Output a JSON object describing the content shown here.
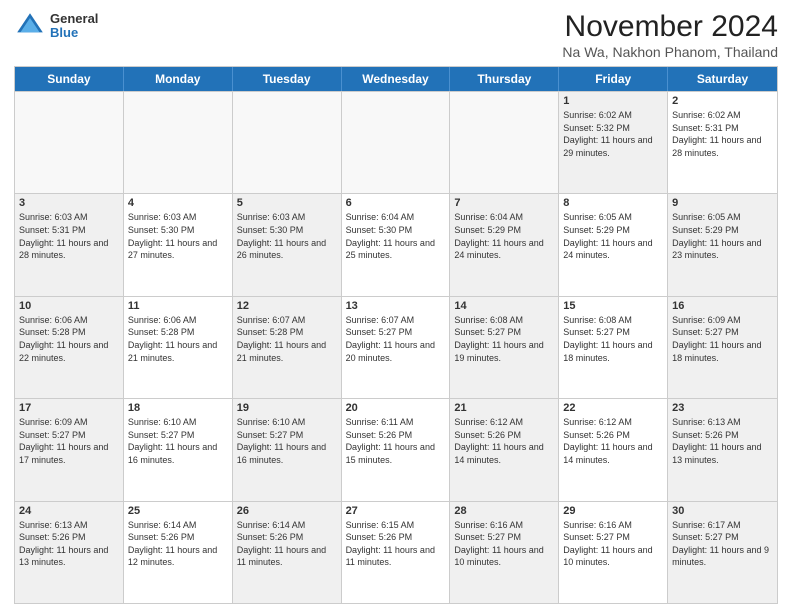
{
  "logo": {
    "general": "General",
    "blue": "Blue"
  },
  "header": {
    "month": "November 2024",
    "location": "Na Wa, Nakhon Phanom, Thailand"
  },
  "weekdays": [
    "Sunday",
    "Monday",
    "Tuesday",
    "Wednesday",
    "Thursday",
    "Friday",
    "Saturday"
  ],
  "rows": [
    [
      {
        "day": "",
        "text": "",
        "empty": true
      },
      {
        "day": "",
        "text": "",
        "empty": true
      },
      {
        "day": "",
        "text": "",
        "empty": true
      },
      {
        "day": "",
        "text": "",
        "empty": true
      },
      {
        "day": "",
        "text": "",
        "empty": true
      },
      {
        "day": "1",
        "text": "Sunrise: 6:02 AM\nSunset: 5:32 PM\nDaylight: 11 hours and 29 minutes.",
        "shaded": true
      },
      {
        "day": "2",
        "text": "Sunrise: 6:02 AM\nSunset: 5:31 PM\nDaylight: 11 hours and 28 minutes.",
        "shaded": false
      }
    ],
    [
      {
        "day": "3",
        "text": "Sunrise: 6:03 AM\nSunset: 5:31 PM\nDaylight: 11 hours and 28 minutes.",
        "shaded": true
      },
      {
        "day": "4",
        "text": "Sunrise: 6:03 AM\nSunset: 5:30 PM\nDaylight: 11 hours and 27 minutes.",
        "shaded": false
      },
      {
        "day": "5",
        "text": "Sunrise: 6:03 AM\nSunset: 5:30 PM\nDaylight: 11 hours and 26 minutes.",
        "shaded": true
      },
      {
        "day": "6",
        "text": "Sunrise: 6:04 AM\nSunset: 5:30 PM\nDaylight: 11 hours and 25 minutes.",
        "shaded": false
      },
      {
        "day": "7",
        "text": "Sunrise: 6:04 AM\nSunset: 5:29 PM\nDaylight: 11 hours and 24 minutes.",
        "shaded": true
      },
      {
        "day": "8",
        "text": "Sunrise: 6:05 AM\nSunset: 5:29 PM\nDaylight: 11 hours and 24 minutes.",
        "shaded": false
      },
      {
        "day": "9",
        "text": "Sunrise: 6:05 AM\nSunset: 5:29 PM\nDaylight: 11 hours and 23 minutes.",
        "shaded": true
      }
    ],
    [
      {
        "day": "10",
        "text": "Sunrise: 6:06 AM\nSunset: 5:28 PM\nDaylight: 11 hours and 22 minutes.",
        "shaded": true
      },
      {
        "day": "11",
        "text": "Sunrise: 6:06 AM\nSunset: 5:28 PM\nDaylight: 11 hours and 21 minutes.",
        "shaded": false
      },
      {
        "day": "12",
        "text": "Sunrise: 6:07 AM\nSunset: 5:28 PM\nDaylight: 11 hours and 21 minutes.",
        "shaded": true
      },
      {
        "day": "13",
        "text": "Sunrise: 6:07 AM\nSunset: 5:27 PM\nDaylight: 11 hours and 20 minutes.",
        "shaded": false
      },
      {
        "day": "14",
        "text": "Sunrise: 6:08 AM\nSunset: 5:27 PM\nDaylight: 11 hours and 19 minutes.",
        "shaded": true
      },
      {
        "day": "15",
        "text": "Sunrise: 6:08 AM\nSunset: 5:27 PM\nDaylight: 11 hours and 18 minutes.",
        "shaded": false
      },
      {
        "day": "16",
        "text": "Sunrise: 6:09 AM\nSunset: 5:27 PM\nDaylight: 11 hours and 18 minutes.",
        "shaded": true
      }
    ],
    [
      {
        "day": "17",
        "text": "Sunrise: 6:09 AM\nSunset: 5:27 PM\nDaylight: 11 hours and 17 minutes.",
        "shaded": true
      },
      {
        "day": "18",
        "text": "Sunrise: 6:10 AM\nSunset: 5:27 PM\nDaylight: 11 hours and 16 minutes.",
        "shaded": false
      },
      {
        "day": "19",
        "text": "Sunrise: 6:10 AM\nSunset: 5:27 PM\nDaylight: 11 hours and 16 minutes.",
        "shaded": true
      },
      {
        "day": "20",
        "text": "Sunrise: 6:11 AM\nSunset: 5:26 PM\nDaylight: 11 hours and 15 minutes.",
        "shaded": false
      },
      {
        "day": "21",
        "text": "Sunrise: 6:12 AM\nSunset: 5:26 PM\nDaylight: 11 hours and 14 minutes.",
        "shaded": true
      },
      {
        "day": "22",
        "text": "Sunrise: 6:12 AM\nSunset: 5:26 PM\nDaylight: 11 hours and 14 minutes.",
        "shaded": false
      },
      {
        "day": "23",
        "text": "Sunrise: 6:13 AM\nSunset: 5:26 PM\nDaylight: 11 hours and 13 minutes.",
        "shaded": true
      }
    ],
    [
      {
        "day": "24",
        "text": "Sunrise: 6:13 AM\nSunset: 5:26 PM\nDaylight: 11 hours and 13 minutes.",
        "shaded": true
      },
      {
        "day": "25",
        "text": "Sunrise: 6:14 AM\nSunset: 5:26 PM\nDaylight: 11 hours and 12 minutes.",
        "shaded": false
      },
      {
        "day": "26",
        "text": "Sunrise: 6:14 AM\nSunset: 5:26 PM\nDaylight: 11 hours and 11 minutes.",
        "shaded": true
      },
      {
        "day": "27",
        "text": "Sunrise: 6:15 AM\nSunset: 5:26 PM\nDaylight: 11 hours and 11 minutes.",
        "shaded": false
      },
      {
        "day": "28",
        "text": "Sunrise: 6:16 AM\nSunset: 5:27 PM\nDaylight: 11 hours and 10 minutes.",
        "shaded": true
      },
      {
        "day": "29",
        "text": "Sunrise: 6:16 AM\nSunset: 5:27 PM\nDaylight: 11 hours and 10 minutes.",
        "shaded": false
      },
      {
        "day": "30",
        "text": "Sunrise: 6:17 AM\nSunset: 5:27 PM\nDaylight: 11 hours and 9 minutes.",
        "shaded": true
      }
    ]
  ]
}
